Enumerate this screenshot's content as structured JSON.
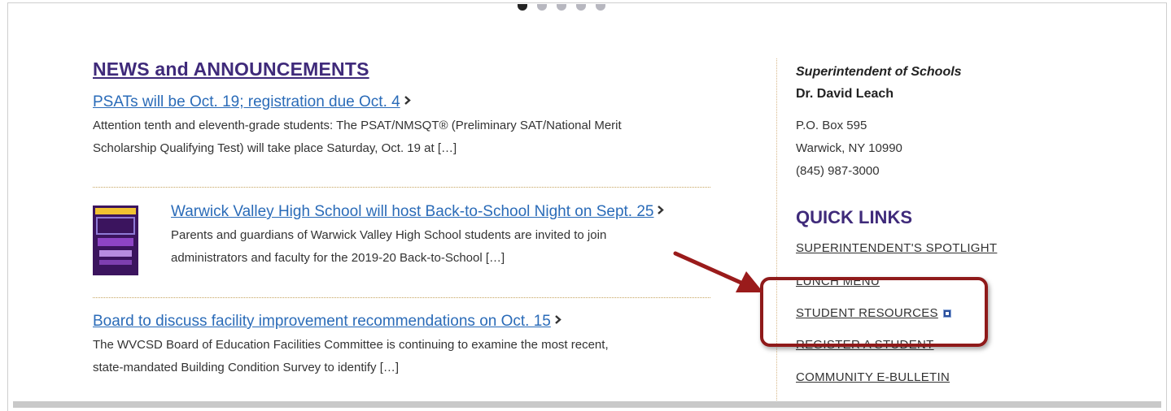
{
  "carousel": {
    "total": 5,
    "active_index": 0
  },
  "news": {
    "heading": "NEWS and ANNOUNCEMENTS",
    "items": [
      {
        "title": "PSATs will be Oct. 19; registration due Oct. 4",
        "desc_line1": "Attention tenth and eleventh-grade students: The PSAT/NMSQT® (Preliminary SAT/National Merit",
        "desc_line2": "Scholarship Qualifying Test) will take place Saturday, Oct. 19 at […]"
      },
      {
        "title": "Warwick Valley High School will host Back-to-School Night on Sept. 25",
        "desc_line1": "Parents and guardians of Warwick Valley High School students are invited to join",
        "desc_line2": "administrators and faculty for the 2019-20 Back-to-School […]",
        "thumbnail": {
          "line1": "Warwick Valley High School",
          "line2": "Back-to-School",
          "line3": "NIGHT",
          "line4": "Wednesday, Sept. 25",
          "line5": "6-8 p.m."
        }
      },
      {
        "title": "Board to discuss facility improvement recommendations on Oct. 15",
        "desc_line1": "The WVCSD Board of Education Facilities Committee is continuing to examine the most recent,",
        "desc_line2": "state-mandated Building Condition Survey to identify […]"
      }
    ]
  },
  "sidebar": {
    "title": "Superintendent of Schools",
    "name": "Dr. David Leach",
    "address1": "P.O. Box 595",
    "address2": "Warwick, NY 10990",
    "phone": "(845) 987-3000",
    "quick_links_heading": "QUICK LINKS",
    "links": [
      {
        "label": "SUPERINTENDENT'S SPOTLIGHT"
      },
      {
        "label": "LUNCH MENU"
      },
      {
        "label": "STUDENT RESOURCES",
        "icon": "external-link-icon"
      },
      {
        "label": "REGISTER A STUDENT"
      },
      {
        "label": "COMMUNITY E-BULLETIN"
      }
    ]
  },
  "colors": {
    "heading": "#3f2a7a",
    "link": "#2a6bb8",
    "annotation": "#8f1a1a",
    "separator": "#c6a45e"
  }
}
